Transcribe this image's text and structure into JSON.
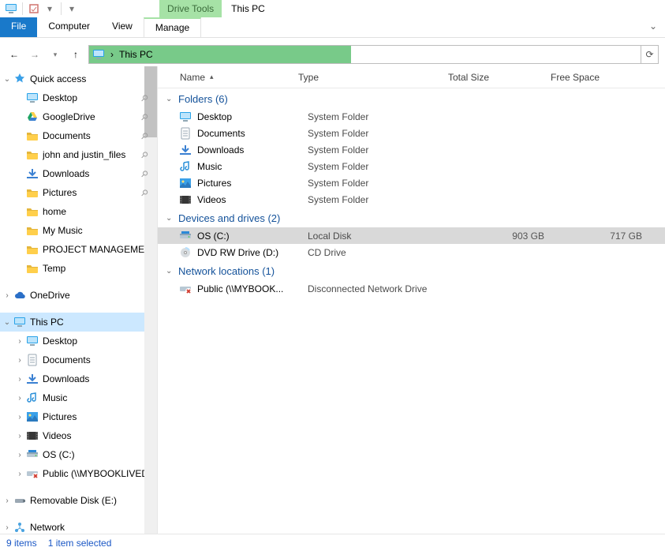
{
  "window": {
    "title": "This PC",
    "drive_tools_label": "Drive Tools"
  },
  "ribbon": {
    "file": "File",
    "computer": "Computer",
    "view": "View",
    "manage": "Manage"
  },
  "address": {
    "location": "This PC"
  },
  "sidebar": {
    "quick_access": "Quick access",
    "qa_items": [
      {
        "label": "Desktop",
        "icon": "desktop",
        "pinned": true
      },
      {
        "label": "GoogleDrive",
        "icon": "gdrive",
        "pinned": true
      },
      {
        "label": "Documents",
        "icon": "folder",
        "pinned": true
      },
      {
        "label": "john and justin_files",
        "icon": "folder",
        "pinned": true
      },
      {
        "label": "Downloads",
        "icon": "downloads",
        "pinned": true
      },
      {
        "label": "Pictures",
        "icon": "folder",
        "pinned": true
      },
      {
        "label": "home",
        "icon": "folder",
        "pinned": false
      },
      {
        "label": "My Music",
        "icon": "folder",
        "pinned": false
      },
      {
        "label": "PROJECT MANAGEMENT and",
        "icon": "folder",
        "pinned": false
      },
      {
        "label": "Temp",
        "icon": "folder",
        "pinned": false
      }
    ],
    "onedrive": "OneDrive",
    "this_pc": "This PC",
    "pc_items": [
      {
        "label": "Desktop",
        "icon": "desktop"
      },
      {
        "label": "Documents",
        "icon": "documents"
      },
      {
        "label": "Downloads",
        "icon": "downloads"
      },
      {
        "label": "Music",
        "icon": "music"
      },
      {
        "label": "Pictures",
        "icon": "pictures"
      },
      {
        "label": "Videos",
        "icon": "videos"
      },
      {
        "label": "OS (C:)",
        "icon": "drive"
      },
      {
        "label": "Public (\\\\MYBOOKLIVEDUO",
        "icon": "netdrive-x"
      }
    ],
    "removable": "Removable Disk (E:)",
    "network": "Network"
  },
  "columns": {
    "name": "Name",
    "type": "Type",
    "total_size": "Total Size",
    "free_space": "Free Space"
  },
  "groups": {
    "folders": {
      "title": "Folders (6)",
      "items": [
        {
          "name": "Desktop",
          "type": "System Folder",
          "icon": "desktop"
        },
        {
          "name": "Documents",
          "type": "System Folder",
          "icon": "documents"
        },
        {
          "name": "Downloads",
          "type": "System Folder",
          "icon": "downloads"
        },
        {
          "name": "Music",
          "type": "System Folder",
          "icon": "music"
        },
        {
          "name": "Pictures",
          "type": "System Folder",
          "icon": "pictures"
        },
        {
          "name": "Videos",
          "type": "System Folder",
          "icon": "videos"
        }
      ]
    },
    "drives": {
      "title": "Devices and drives (2)",
      "items": [
        {
          "name": "OS (C:)",
          "type": "Local Disk",
          "size": "903 GB",
          "free": "717 GB",
          "icon": "drive",
          "selected": true
        },
        {
          "name": "DVD RW Drive (D:)",
          "type": "CD Drive",
          "size": "",
          "free": "",
          "icon": "dvd"
        }
      ]
    },
    "network": {
      "title": "Network locations (1)",
      "items": [
        {
          "name": "Public (\\\\MYBOOK...",
          "type": "Disconnected Network Drive",
          "icon": "netdrive-x"
        }
      ]
    }
  },
  "status": {
    "count": "9 items",
    "selection": "1 item selected"
  }
}
